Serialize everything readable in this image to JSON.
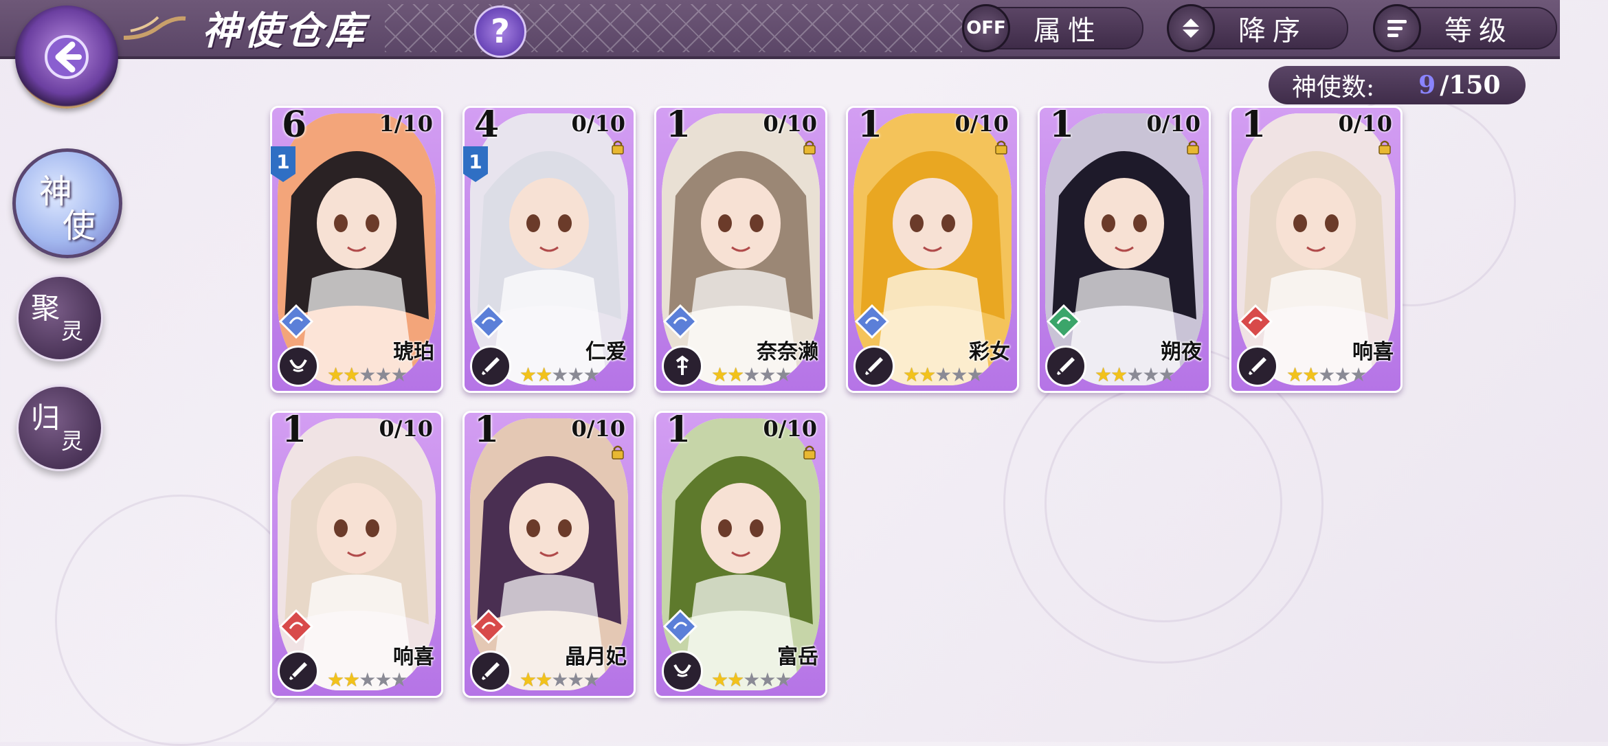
{
  "header": {
    "title": "神使仓库",
    "help": "?",
    "controls": [
      {
        "knob": "OFF",
        "label": "属性"
      },
      {
        "knob": "sort-updown-icon",
        "label": "降序"
      },
      {
        "knob": "list-icon",
        "label": "等级"
      }
    ],
    "count_label": "神使数:",
    "count_value": "9",
    "count_max": "/150"
  },
  "side_menu": [
    {
      "line1": "神",
      "line2": "使",
      "active": true
    },
    {
      "line1": "聚",
      "line2": "灵",
      "active": false
    },
    {
      "line1": "归",
      "line2": "灵",
      "active": false
    }
  ],
  "cards": [
    {
      "level": "6",
      "frag": "1/10",
      "locked": false,
      "badge": "1",
      "name": "琥珀",
      "element": "blue",
      "role": "claw",
      "stars_on": 2,
      "stars_total": 5,
      "bg": "#f3a57a",
      "hair": "#2a2224"
    },
    {
      "level": "4",
      "frag": "0/10",
      "locked": true,
      "badge": "1",
      "name": "仁爱",
      "element": "blue",
      "role": "sword",
      "stars_on": 2,
      "stars_total": 5,
      "bg": "#e8e4ee",
      "hair": "#dcdde6"
    },
    {
      "level": "1",
      "frag": "0/10",
      "locked": true,
      "badge": "",
      "name": "奈奈濑",
      "element": "blue",
      "role": "staff",
      "stars_on": 2,
      "stars_total": 5,
      "bg": "#e9e0d4",
      "hair": "#9b8775"
    },
    {
      "level": "1",
      "frag": "0/10",
      "locked": true,
      "badge": "",
      "name": "彩女",
      "element": "blue",
      "role": "sword",
      "stars_on": 2,
      "stars_total": 5,
      "bg": "#f4c35a",
      "hair": "#e9a722"
    },
    {
      "level": "1",
      "frag": "0/10",
      "locked": true,
      "badge": "",
      "name": "朔夜",
      "element": "green",
      "role": "sword",
      "stars_on": 2,
      "stars_total": 5,
      "bg": "#c9c3d6",
      "hair": "#1e1a2a"
    },
    {
      "level": "1",
      "frag": "0/10",
      "locked": true,
      "badge": "",
      "name": "响喜",
      "element": "red",
      "role": "sword",
      "stars_on": 2,
      "stars_total": 5,
      "bg": "#f0e3e4",
      "hair": "#e8d8c8"
    },
    {
      "level": "1",
      "frag": "0/10",
      "locked": false,
      "badge": "",
      "name": "响喜",
      "element": "red",
      "role": "sword",
      "stars_on": 2,
      "stars_total": 5,
      "bg": "#f0e3e4",
      "hair": "#e8d8c8"
    },
    {
      "level": "1",
      "frag": "0/10",
      "locked": true,
      "badge": "",
      "name": "晶月妃",
      "element": "red",
      "role": "sword",
      "stars_on": 2,
      "stars_total": 5,
      "bg": "#e4c8b4",
      "hair": "#4a2f52"
    },
    {
      "level": "1",
      "frag": "0/10",
      "locked": true,
      "badge": "",
      "name": "富岳",
      "element": "blue",
      "role": "claw",
      "stars_on": 2,
      "stars_total": 5,
      "bg": "#c6d5a8",
      "hair": "#5e7a2c"
    }
  ],
  "colors": {
    "accent": "#b574e6",
    "bar": "#5a4566",
    "count": "#8a84ff"
  }
}
